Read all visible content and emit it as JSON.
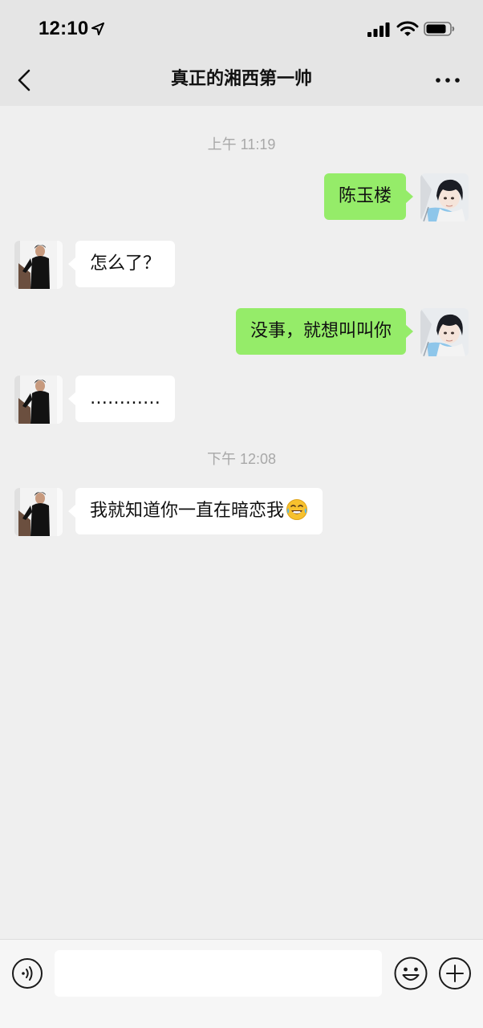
{
  "status_bar": {
    "time": "12:10",
    "icons": [
      "location-arrow-icon",
      "cellular-signal-icon",
      "wifi-icon",
      "battery-icon"
    ]
  },
  "header": {
    "title": "真正的湘西第一帅",
    "back_icon": "chevron-left-icon",
    "more_icon": "more-dots-icon"
  },
  "messages": [
    {
      "type": "timestamp",
      "text": "上午 11:19"
    },
    {
      "type": "message",
      "side": "right",
      "text": "陈玉楼"
    },
    {
      "type": "message",
      "side": "left",
      "text": "怎么了？"
    },
    {
      "type": "message",
      "side": "right",
      "text": "没事，就想叫叫你"
    },
    {
      "type": "message",
      "side": "left",
      "text": "…………"
    },
    {
      "type": "timestamp",
      "text": "下午 12:08"
    },
    {
      "type": "message",
      "side": "left",
      "text": "我就知道你一直在暗恋我",
      "emoji": "laughing-crying-emoji"
    }
  ],
  "input_bar": {
    "voice_icon": "voice-icon",
    "text_value": "",
    "emoji_icon": "smiley-icon",
    "plus_icon": "plus-circle-icon"
  },
  "colors": {
    "sent_bubble": "#95ec69",
    "received_bubble": "#ffffff",
    "background": "#efefef",
    "header_bg": "#e5e5e5",
    "timestamp": "#a8a8a8"
  }
}
